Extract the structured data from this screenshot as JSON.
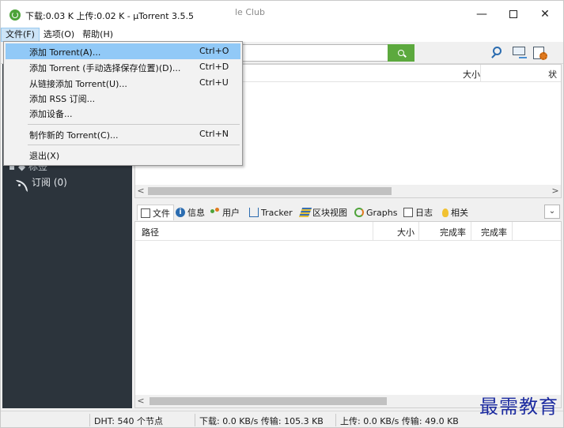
{
  "window": {
    "title": "下载:0.03 K 上传:0.02 K - μTorrent 3.5.5",
    "minimize_glyph": "—",
    "close_glyph": "✕"
  },
  "menubar": {
    "items": [
      {
        "label": "文件(F)"
      },
      {
        "label": "选项(O)"
      },
      {
        "label": "帮助(H)"
      }
    ]
  },
  "toolbar": {
    "search_placeholder_visible": "le Club",
    "icons": [
      "search-icon",
      "remote-icon",
      "settings-icon"
    ]
  },
  "file_menu": {
    "items": [
      {
        "label": "添加 Torrent(A)...",
        "shortcut": "Ctrl+O"
      },
      {
        "label": "添加 Torrent (手动选择保存位置)(D)...",
        "shortcut": "Ctrl+D"
      },
      {
        "label": "从链接添加 Torrent(U)...",
        "shortcut": "Ctrl+U"
      },
      {
        "label": "添加 RSS 订阅...",
        "shortcut": ""
      },
      {
        "label": "添加设备...",
        "shortcut": ""
      },
      {
        "label": "制作新的 Torrent(C)...",
        "shortcut": "Ctrl+N"
      },
      {
        "label": "退出(X)",
        "shortcut": ""
      }
    ]
  },
  "sidebar": {
    "partial_label": "▪ ◆ 标签",
    "feeds_label": "订阅 (0)"
  },
  "torrent_list": {
    "columns": [
      {
        "label": "大小"
      },
      {
        "label": "状"
      }
    ]
  },
  "detail_tabs": [
    {
      "label": "文件",
      "icon": "files-icon"
    },
    {
      "label": "信息",
      "icon": "info-icon"
    },
    {
      "label": "用户",
      "icon": "peers-icon"
    },
    {
      "label": "Tracker",
      "icon": "tracker-icon"
    },
    {
      "label": "区块视图",
      "icon": "pieces-icon"
    },
    {
      "label": "Graphs",
      "icon": "graphs-icon"
    },
    {
      "label": "日志",
      "icon": "log-icon"
    },
    {
      "label": "相关",
      "icon": "related-icon"
    }
  ],
  "files_table": {
    "columns": [
      {
        "label": "路径"
      },
      {
        "label": "大小"
      },
      {
        "label": "完成率"
      },
      {
        "label": "完成率"
      }
    ]
  },
  "statusbar": {
    "dht": "DHT: 540 个节点",
    "download": "下载: 0.0 KB/s 传输: 105.3 KB",
    "upload": "上传: 0.0 KB/s 传输: 49.0 KB"
  },
  "watermark": "最需教育"
}
